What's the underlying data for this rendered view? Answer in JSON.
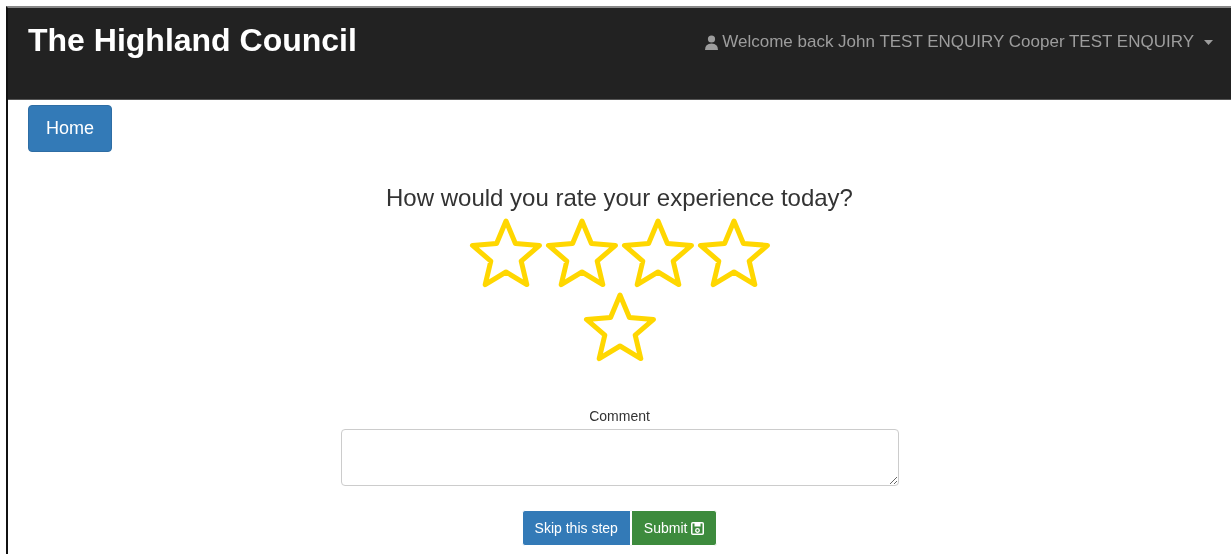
{
  "navbar": {
    "brand": "The Highland Council",
    "user_menu": "Welcome back John TEST ENQUIRY Cooper TEST ENQUIRY"
  },
  "home_button": "Home",
  "rating": {
    "question": "How would you rate your experience today?",
    "stars": 0
  },
  "comment": {
    "label": "Comment"
  },
  "buttons": [
    {
      "kind": "skip",
      "label": "Skip this step"
    },
    {
      "kind": "submit",
      "label": "Submit"
    }
  ]
}
